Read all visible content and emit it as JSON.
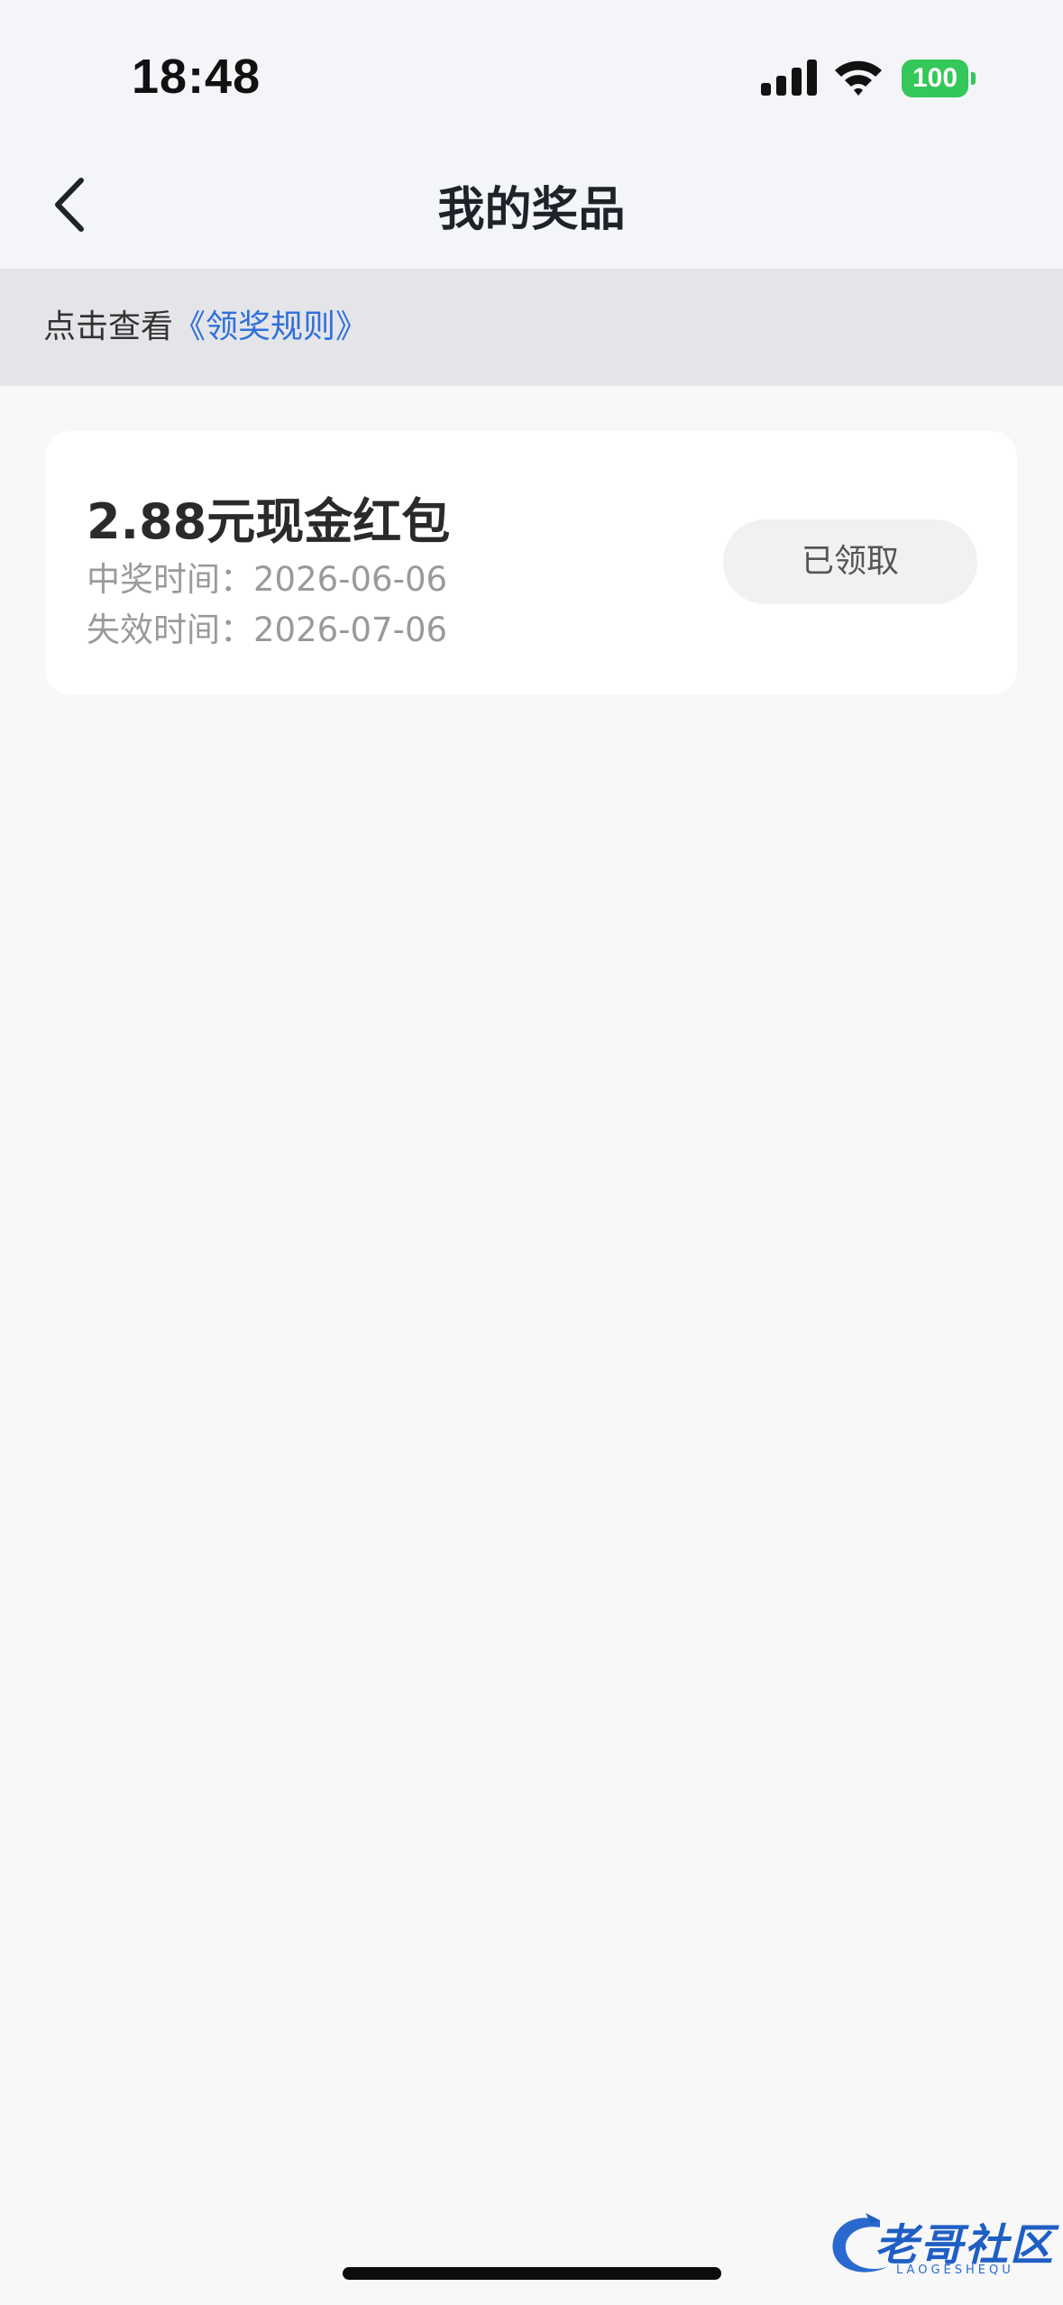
{
  "status_bar": {
    "time": "18:48",
    "battery": "100",
    "icons": [
      "signal-icon",
      "wifi-icon",
      "battery-icon"
    ],
    "battery_color": "#34c759"
  },
  "nav": {
    "title": "我的奖品",
    "back_icon": "chevron-left-icon"
  },
  "rules": {
    "prefix": "点击查看",
    "link": "《领奖规则》",
    "link_color": "#2f6fdc"
  },
  "prizes": [
    {
      "title": "2.88元现金红包",
      "won_label": "中奖时间：",
      "won_date": "2026-06-06",
      "expire_label": "失效时间：",
      "expire_date": "2026-07-06",
      "status": "已领取"
    }
  ],
  "watermark": {
    "main": "老哥社区",
    "sub": "LAOGESHEQU"
  }
}
